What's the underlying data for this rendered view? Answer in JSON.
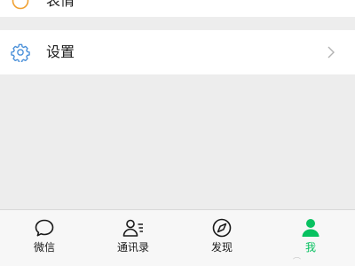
{
  "top_item": {
    "label": "表情",
    "icon": "emoji-icon"
  },
  "settings_item": {
    "label": "设置",
    "icon": "gear-icon"
  },
  "tabbar": {
    "tabs": [
      {
        "label": "微信",
        "icon": "chat-bubble-icon",
        "active": false
      },
      {
        "label": "通讯录",
        "icon": "contacts-icon",
        "active": false
      },
      {
        "label": "发现",
        "icon": "compass-icon",
        "active": false
      },
      {
        "label": "我",
        "icon": "person-icon",
        "active": true
      }
    ]
  },
  "colors": {
    "accent": "#07c160",
    "settings_icon": "#4a90d9",
    "top_icon": "#f0a030",
    "background": "#ededed"
  }
}
